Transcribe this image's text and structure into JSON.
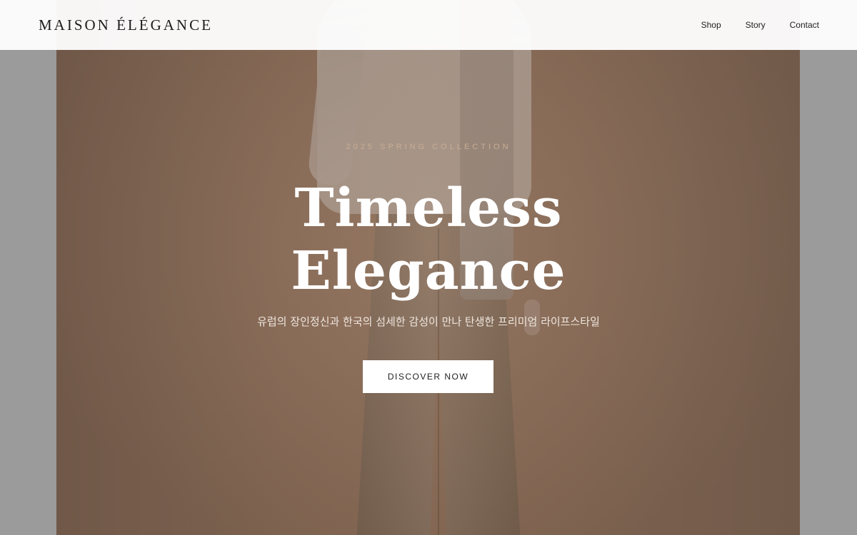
{
  "header": {
    "logo": "MAISON ÉLÉGANCE",
    "nav": [
      {
        "label": "Shop"
      },
      {
        "label": "Story"
      },
      {
        "label": "Contact"
      }
    ]
  },
  "hero": {
    "eyebrow": "2025 SPRING COLLECTION",
    "title_line1": "Timeless",
    "title_line2": "Elegance",
    "subtitle": "유럽의 장인정신과 한국의 섬세한 감성이 만나 탄생한 프리미엄 라이프스타일",
    "cta_label": "DISCOVER NOW"
  },
  "colors": {
    "eyebrow": "#c9ad94",
    "backdrop": "#8f705a",
    "header_bg": "#ffffff"
  }
}
